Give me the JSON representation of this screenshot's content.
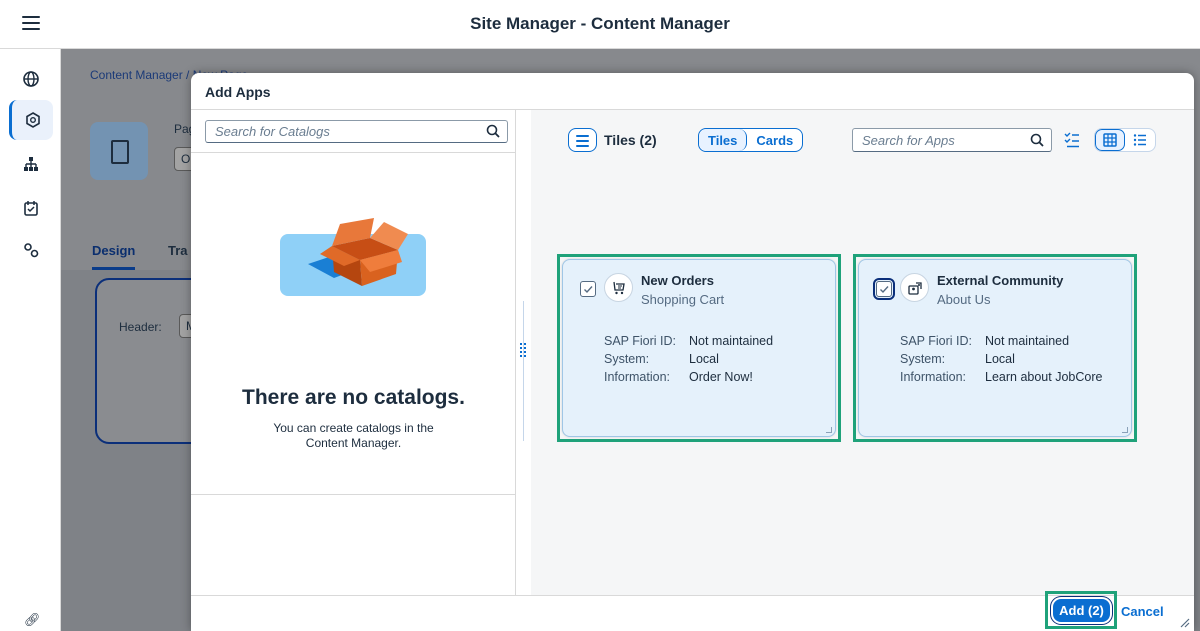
{
  "shell": {
    "title": "Site Manager - Content Manager"
  },
  "background": {
    "breadcrumb": "Content Manager / New Page",
    "page_label": "Pag",
    "page_field": "O",
    "tabs": [
      "Design",
      "Tra"
    ],
    "header_label": "Header:",
    "header_field": "M"
  },
  "dialog": {
    "title": "Add Apps",
    "catalogs": {
      "search_placeholder": "Search for Catalogs",
      "empty_title": "There are no catalogs.",
      "empty_desc": "You can create catalogs in the Content Manager."
    },
    "toolbar": {
      "tiles_count": "Tiles (2)",
      "view_options": [
        "Tiles",
        "Cards"
      ],
      "selected_view": "Tiles",
      "search_placeholder": "Search for Apps"
    },
    "tiles": [
      {
        "title": "New Orders",
        "subtitle": "Shopping Cart",
        "icon": "shopping-cart-icon",
        "checked": true,
        "props": [
          {
            "label": "SAP Fiori ID:",
            "value": "Not maintained"
          },
          {
            "label": "System:",
            "value": "Local"
          },
          {
            "label": "Information:",
            "value": "Order Now!"
          }
        ]
      },
      {
        "title": "External Community",
        "subtitle": "About Us",
        "icon": "community-icon",
        "checked": true,
        "props": [
          {
            "label": "SAP Fiori ID:",
            "value": "Not maintained"
          },
          {
            "label": "System:",
            "value": "Local"
          },
          {
            "label": "Information:",
            "value": "Learn about JobCore"
          }
        ]
      }
    ],
    "footer": {
      "add_label": "Add (2)",
      "cancel_label": "Cancel"
    }
  },
  "colors": {
    "accent": "#0a6ed1",
    "highlight": "#1fa27a",
    "tile_bg": "#e5f1fb"
  }
}
